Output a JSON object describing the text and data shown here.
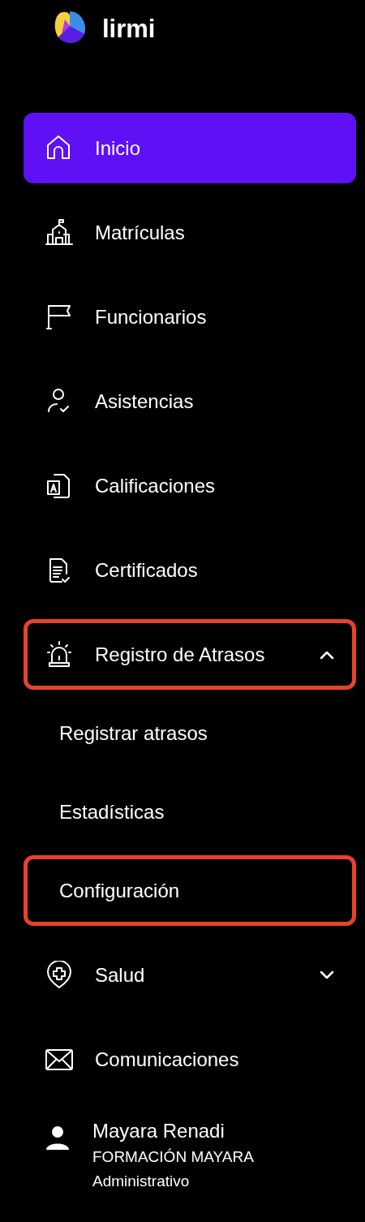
{
  "brand": {
    "name": "lirmi"
  },
  "nav": [
    {
      "kind": "item",
      "label": "Inicio",
      "selected": true,
      "highlighted": false
    },
    {
      "kind": "item",
      "label": "Matrículas",
      "selected": false,
      "highlighted": false
    },
    {
      "kind": "item",
      "label": "Funcionarios",
      "selected": false,
      "highlighted": false
    },
    {
      "kind": "item",
      "label": "Asistencias",
      "selected": false,
      "highlighted": false
    },
    {
      "kind": "item",
      "label": "Calificaciones",
      "selected": false,
      "highlighted": false
    },
    {
      "kind": "item",
      "label": "Certificados",
      "selected": false,
      "highlighted": false
    },
    {
      "kind": "group",
      "label": "Registro de Atrasos",
      "selected": false,
      "highlighted": true,
      "expanded": true,
      "children": [
        {
          "label": "Registrar atrasos",
          "selected": false,
          "highlighted": false
        },
        {
          "label": "Estadísticas",
          "selected": false,
          "highlighted": false
        },
        {
          "label": "Configuración",
          "selected": false,
          "highlighted": true
        }
      ]
    },
    {
      "kind": "group",
      "label": "Salud",
      "selected": false,
      "highlighted": false,
      "expanded": false
    },
    {
      "kind": "item",
      "label": "Comunicaciones",
      "selected": false,
      "highlighted": false
    }
  ],
  "user": {
    "name": "Mayara Renadi",
    "organization": "FORMACIÓN MAYARA",
    "role": "Administrativo"
  }
}
